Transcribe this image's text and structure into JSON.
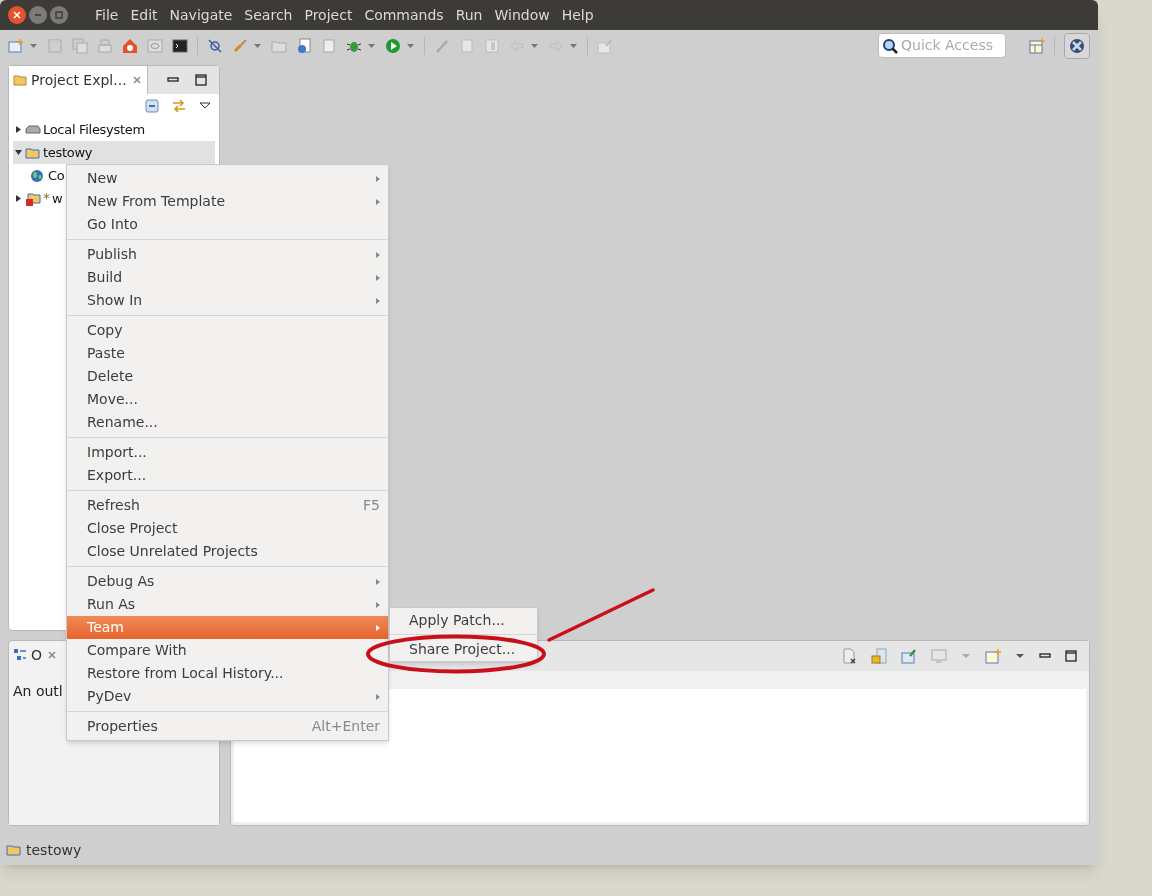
{
  "window": {
    "menu": [
      "File",
      "Edit",
      "Navigate",
      "Search",
      "Project",
      "Commands",
      "Run",
      "Window",
      "Help"
    ]
  },
  "toolbar": {
    "quick_access": {
      "placeholder": "Quick Access"
    }
  },
  "project_explorer": {
    "title": "Project Expl...",
    "tree": [
      {
        "label": "Local Filesystem",
        "expanded": false,
        "selected": false
      },
      {
        "label": "testowy",
        "expanded": true,
        "selected": true,
        "children": [
          {
            "label": "Co",
            "selected": false
          }
        ]
      },
      {
        "label": "w",
        "prefix": "*",
        "expanded": false,
        "selected": false
      }
    ]
  },
  "outline": {
    "title": "O",
    "message": "An outl"
  },
  "context_menu": {
    "groups": [
      [
        {
          "label": "New",
          "submenu": true,
          "selected": false
        },
        {
          "label": "New From Template",
          "submenu": true,
          "selected": false
        },
        {
          "label": "Go Into",
          "submenu": false,
          "selected": false
        }
      ],
      [
        {
          "label": "Publish",
          "submenu": true,
          "selected": false
        },
        {
          "label": "Build",
          "submenu": true,
          "selected": false
        },
        {
          "label": "Show In",
          "submenu": true,
          "selected": false
        }
      ],
      [
        {
          "label": "Copy",
          "submenu": false,
          "selected": false
        },
        {
          "label": "Paste",
          "submenu": false,
          "selected": false
        },
        {
          "label": "Delete",
          "submenu": false,
          "selected": false
        },
        {
          "label": "Move...",
          "submenu": false,
          "selected": false
        },
        {
          "label": "Rename...",
          "submenu": false,
          "selected": false
        }
      ],
      [
        {
          "label": "Import...",
          "submenu": false,
          "selected": false
        },
        {
          "label": "Export...",
          "submenu": false,
          "selected": false
        }
      ],
      [
        {
          "label": "Refresh",
          "shortcut": "F5",
          "submenu": false,
          "selected": false
        },
        {
          "label": "Close Project",
          "submenu": false,
          "selected": false
        },
        {
          "label": "Close Unrelated Projects",
          "submenu": false,
          "selected": false
        }
      ],
      [
        {
          "label": "Debug As",
          "submenu": true,
          "selected": false
        },
        {
          "label": "Run As",
          "submenu": true,
          "selected": false
        },
        {
          "label": "Team",
          "submenu": true,
          "selected": true
        },
        {
          "label": "Compare With",
          "submenu": false,
          "selected": false
        },
        {
          "label": "Restore from Local History...",
          "submenu": false,
          "selected": false
        },
        {
          "label": "PyDev",
          "submenu": true,
          "selected": false
        }
      ],
      [
        {
          "label": "Properties",
          "shortcut": "Alt+Enter",
          "submenu": false,
          "selected": false
        }
      ]
    ]
  },
  "team_submenu": [
    {
      "label": "Apply Patch..."
    },
    {
      "label": "Share Project..."
    }
  ],
  "status_bar": {
    "text": "testowy"
  }
}
